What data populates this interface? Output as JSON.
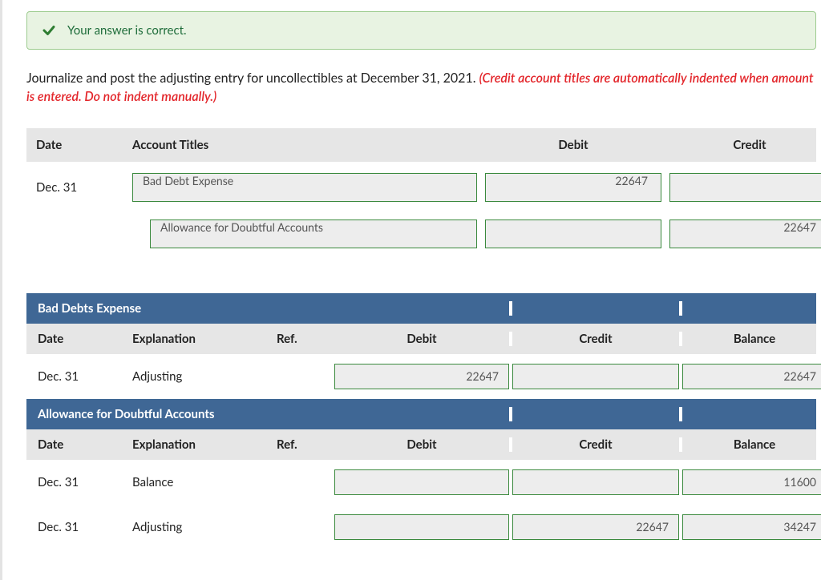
{
  "banner": {
    "text": "Your answer is correct."
  },
  "instruction": {
    "plain": "Journalize and post the adjusting entry for uncollectibles at December 31, 2021. ",
    "hint": "(Credit account titles are automatically indented when amount is entered. Do not indent manually.)"
  },
  "journal": {
    "headers": {
      "date": "Date",
      "titles": "Account Titles",
      "debit": "Debit",
      "credit": "Credit"
    },
    "rows": [
      {
        "date": "Dec. 31",
        "account": "Bad Debt Expense",
        "indent": false,
        "debit": "22647",
        "credit": ""
      },
      {
        "date": "",
        "account": "Allowance for Doubtful Accounts",
        "indent": true,
        "debit": "",
        "credit": "22647"
      }
    ]
  },
  "ledgers": [
    {
      "title": "Bad Debts Expense",
      "headers": {
        "date": "Date",
        "explanation": "Explanation",
        "ref": "Ref.",
        "debit": "Debit",
        "credit": "Credit",
        "balance": "Balance"
      },
      "rows": [
        {
          "date": "Dec. 31",
          "explanation": "Adjusting",
          "debit": "22647",
          "credit": "",
          "balance": "22647"
        }
      ]
    },
    {
      "title": "Allowance for Doubtful Accounts",
      "headers": {
        "date": "Date",
        "explanation": "Explanation",
        "ref": "Ref.",
        "debit": "Debit",
        "credit": "Credit",
        "balance": "Balance"
      },
      "rows": [
        {
          "date": "Dec. 31",
          "explanation": "Balance",
          "debit": "",
          "credit": "",
          "balance": "11600"
        },
        {
          "date": "Dec. 31",
          "explanation": "Adjusting",
          "debit": "",
          "credit": "22647",
          "balance": "34247"
        }
      ]
    }
  ]
}
